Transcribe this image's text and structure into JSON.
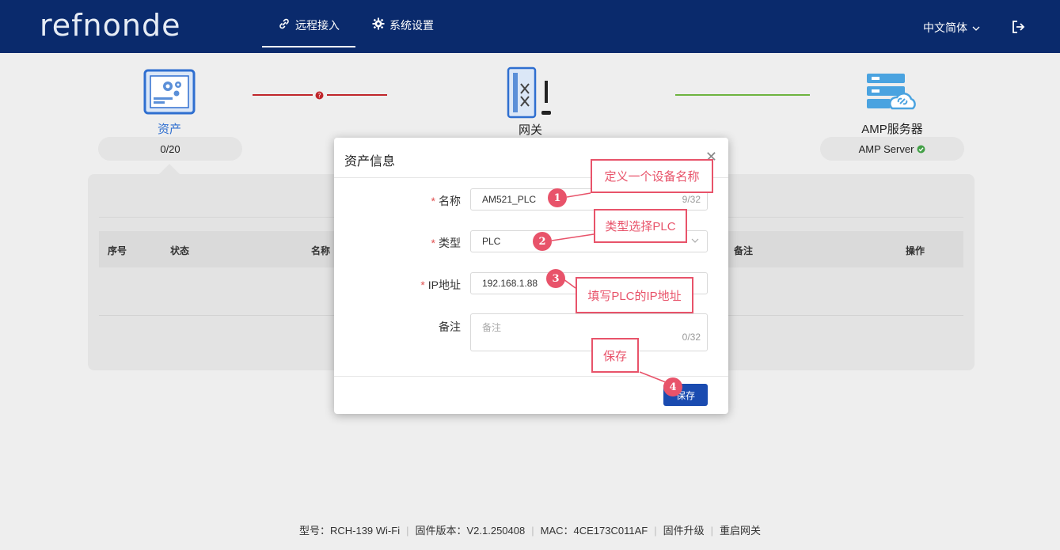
{
  "app": {
    "logo": "refnonde"
  },
  "nav": {
    "tabs": [
      {
        "label": "远程接入",
        "icon": "link-icon",
        "active": true
      },
      {
        "label": "系统设置",
        "icon": "gear-icon",
        "active": false
      }
    ],
    "language": "中文简体"
  },
  "topology": {
    "asset": {
      "label": "资产",
      "count": "0/20"
    },
    "gateway": {
      "label": "网关"
    },
    "server": {
      "label": "AMP服务器",
      "status": "AMP Server"
    }
  },
  "table": {
    "headers": [
      "序号",
      "状态",
      "名称",
      "备注",
      "操作"
    ]
  },
  "footer": {
    "model": "型号：RCH-139  Wi-Fi",
    "firmware": "固件版本：V2.1.250408",
    "mac": "MAC：4CE173C011AF",
    "upgrade": "固件升级",
    "reboot": "重启网关"
  },
  "modal": {
    "title": "资产信息",
    "fields": {
      "name": {
        "label": "名称",
        "value": "AM521_PLC",
        "count": "9/32"
      },
      "type": {
        "label": "类型",
        "value": "PLC"
      },
      "ip": {
        "label": "IP地址",
        "value": "192.168.1.88"
      },
      "remark": {
        "label": "备注",
        "placeholder": "备注",
        "count": "0/32"
      }
    },
    "save_label": "保存"
  },
  "annotations": [
    {
      "num": "1",
      "text": "定义一个设备名称"
    },
    {
      "num": "2",
      "text": "类型选择PLC"
    },
    {
      "num": "3",
      "text": "填写PLC的IP地址"
    },
    {
      "num": "4",
      "text": "保存"
    }
  ],
  "colors": {
    "header": "#0a2a6c",
    "accent": "#1a4bb0",
    "annotation": "#e8536a",
    "link_error": "#c0262b",
    "link_ok": "#6db33f"
  }
}
